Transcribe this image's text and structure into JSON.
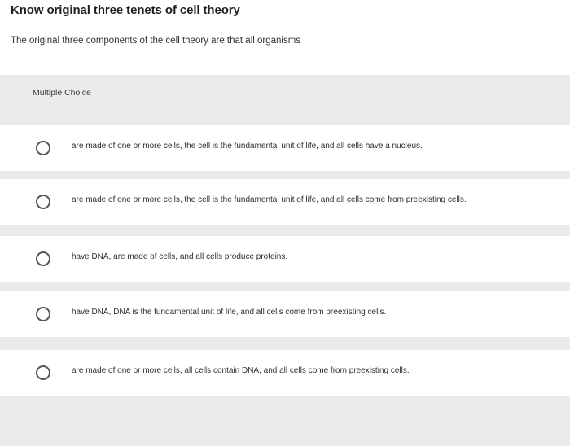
{
  "header": {
    "title": "Know original three tenets of cell theory"
  },
  "question": {
    "prompt": "The original three components of the cell theory are that all organisms"
  },
  "answer_panel": {
    "type_label": "Multiple Choice",
    "options": [
      {
        "label": "are made of one or more cells, the cell is the fundamental unit of life, and all cells have a nucleus."
      },
      {
        "label": "are made of one or more cells, the cell is the fundamental unit of life, and all cells come from preexisting cells."
      },
      {
        "label": "have DNA, are made of cells, and all cells produce proteins."
      },
      {
        "label": "have DNA, DNA is the fundamental unit of life, and all cells come from preexisting cells."
      },
      {
        "label": "are made of one or more cells, all cells contain DNA, and all cells come from preexisting cells."
      }
    ]
  },
  "colors": {
    "panel_background": "#ebebeb",
    "option_background": "#ffffff",
    "radio_border": "#555555"
  }
}
